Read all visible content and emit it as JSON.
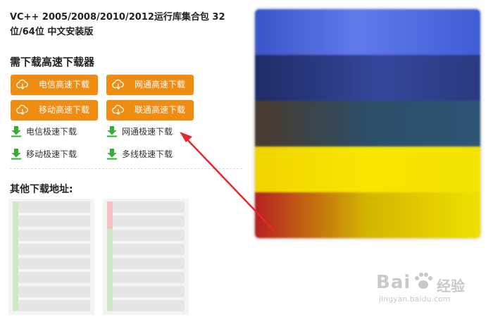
{
  "page": {
    "title": "VC++ 2005/2008/2010/2012运行库集合包 32位/64位 中文安装版"
  },
  "downloaders": {
    "heading": "需下载高速下载器",
    "buttons": [
      {
        "label": "电信高速下载",
        "icon": "cloud-download-icon"
      },
      {
        "label": "网通高速下载",
        "icon": "cloud-download-icon"
      },
      {
        "label": "移动高速下载",
        "icon": "cloud-download-icon"
      },
      {
        "label": "联通高速下载",
        "icon": "cloud-download-icon"
      }
    ],
    "links": [
      {
        "label": "电信极速下载",
        "icon": "download-arrow-icon"
      },
      {
        "label": "网通极速下载",
        "icon": "download-arrow-icon"
      },
      {
        "label": "移动极速下载",
        "icon": "download-arrow-icon"
      },
      {
        "label": "多线极速下载",
        "icon": "download-arrow-icon"
      }
    ],
    "button_color": "#f08c12",
    "link_icon_color": "#3bab3b"
  },
  "other_addresses": {
    "heading": "其他下载地址:"
  },
  "annotation": {
    "arrow_color": "#e8262c"
  },
  "watermark": {
    "brand": "Bai",
    "brand_cn": "经验",
    "url": "jingyan.baidu.com"
  }
}
